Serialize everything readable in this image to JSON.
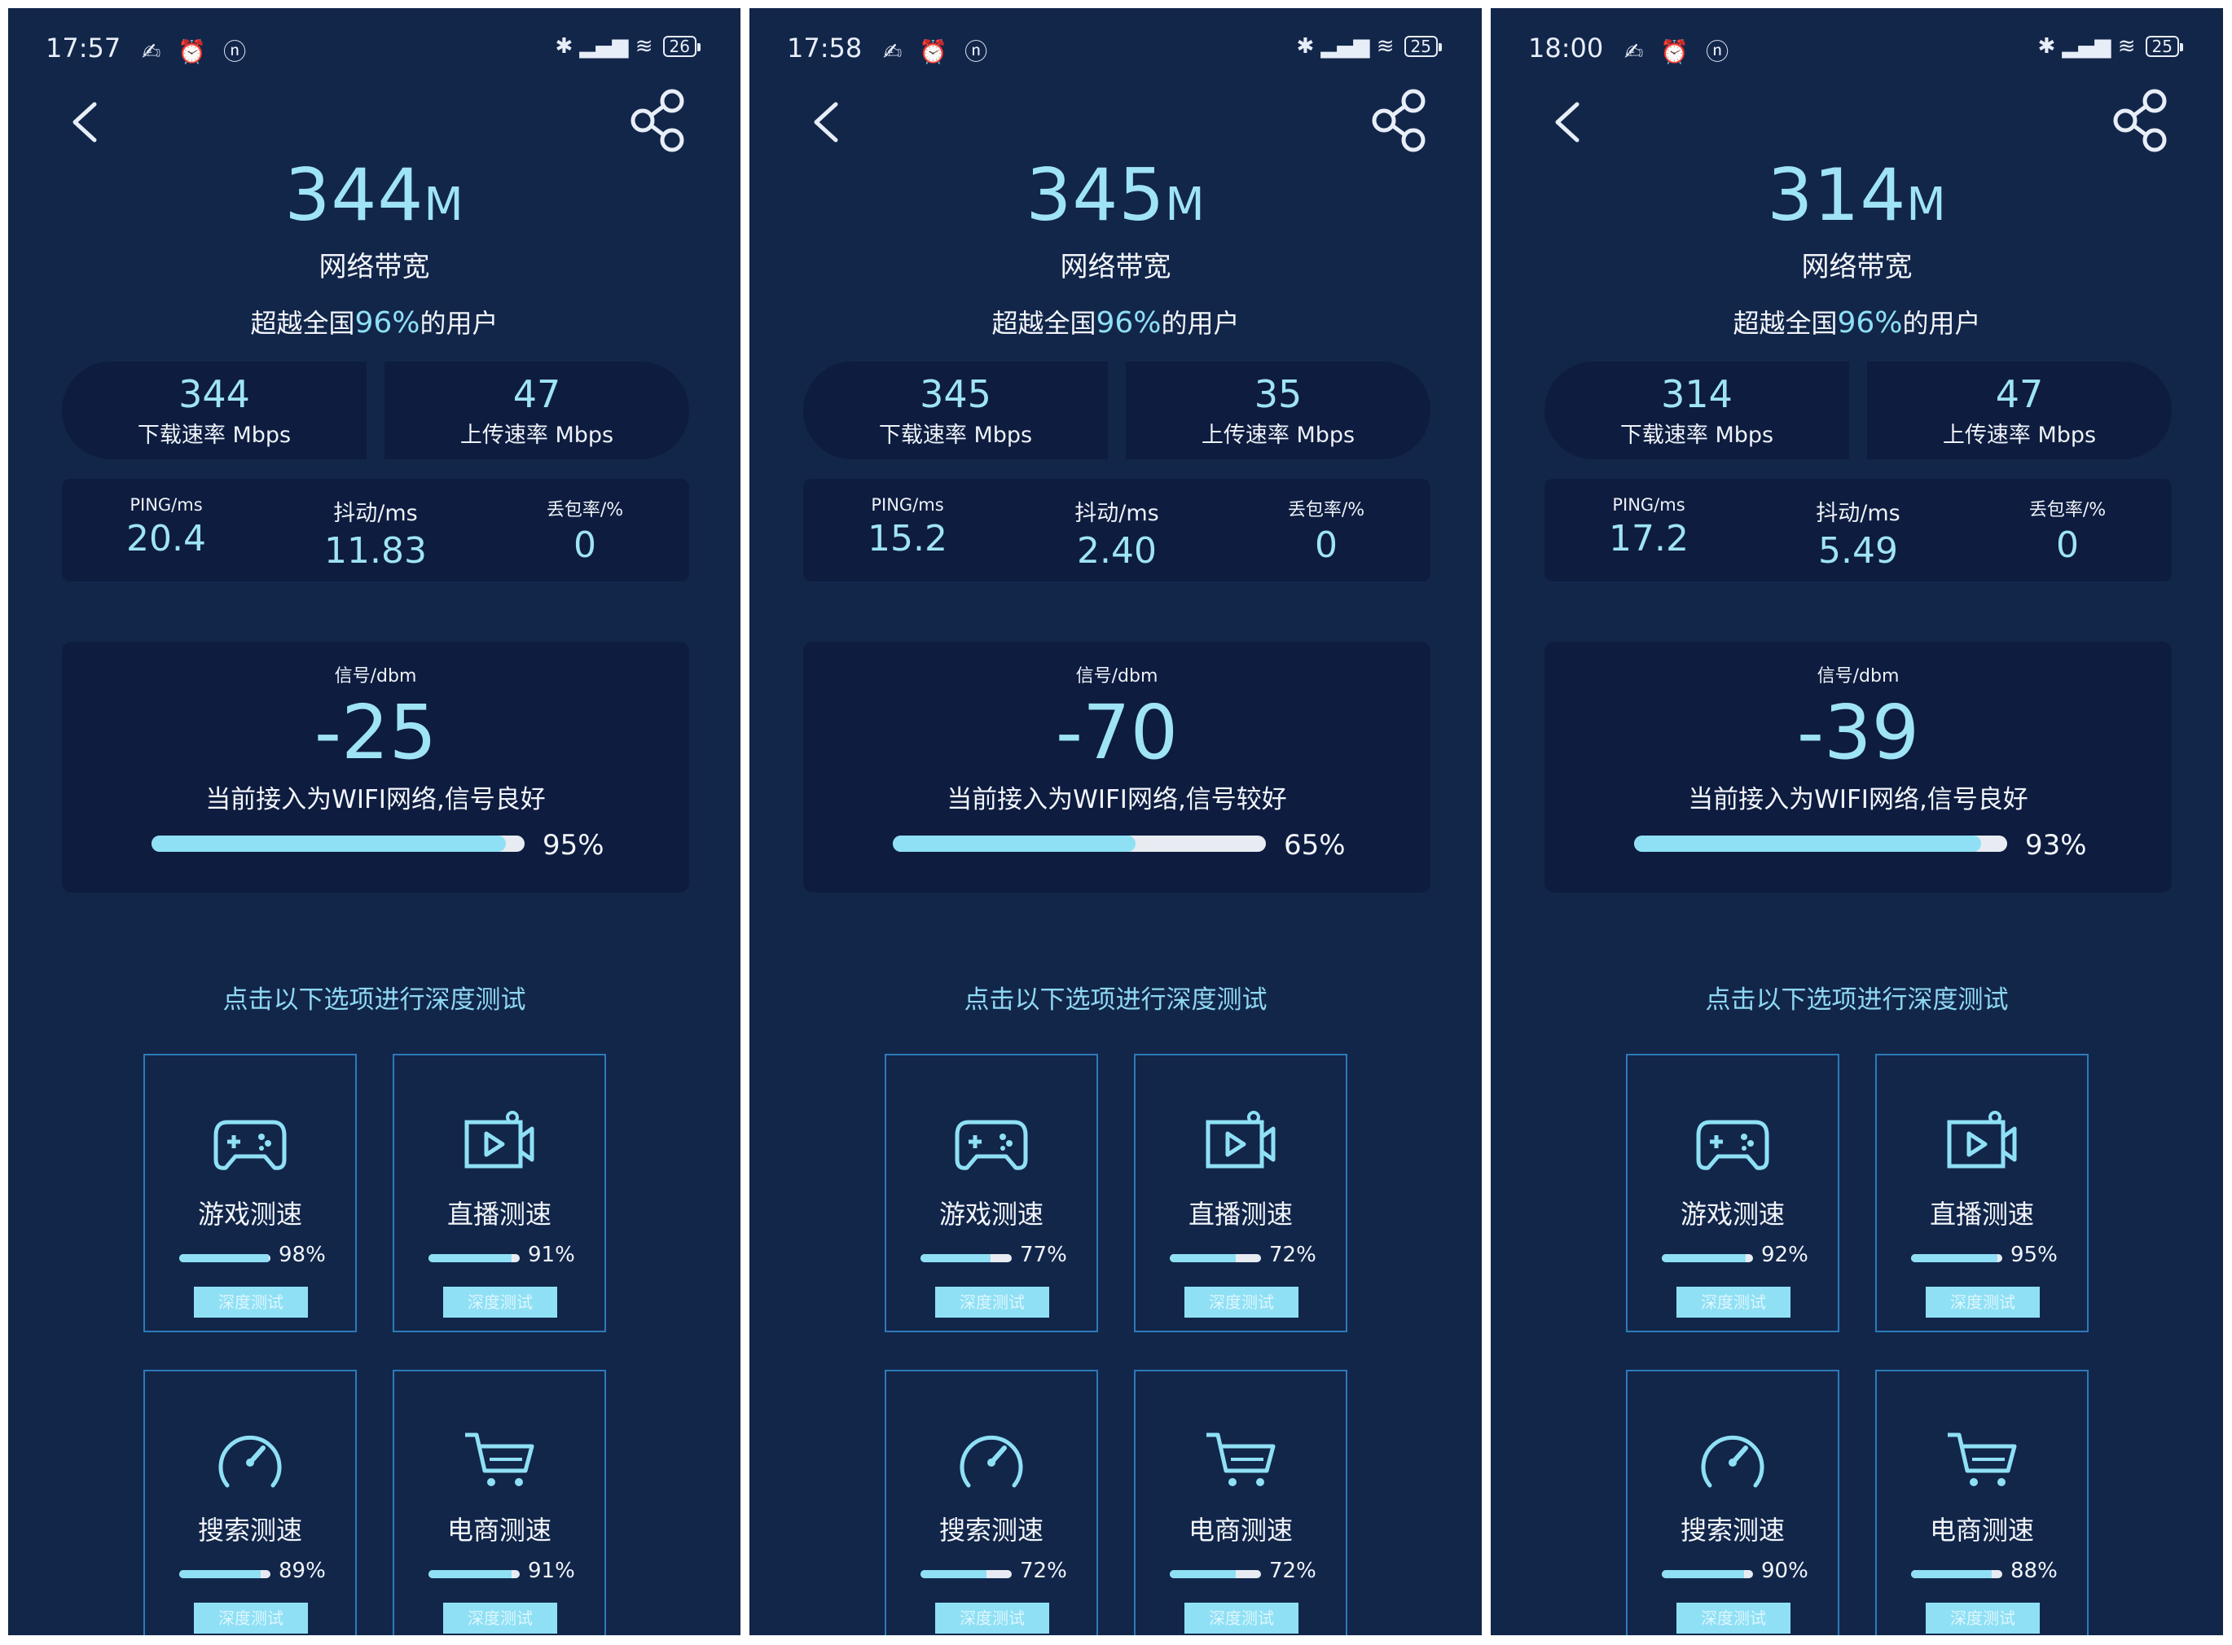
{
  "colors": {
    "background": "#12264a",
    "panel": "#0d1c3f",
    "accent": "#9fe3f7",
    "card_border": "#2d7ab8"
  },
  "screens": [
    {
      "status": {
        "time": "17:57",
        "left_icons": "✍ ⏰ ⓝ",
        "right_icons": "✱ ▂▄▆ ≋",
        "battery": "26"
      },
      "bandwidth": {
        "value": "344",
        "unit": "M",
        "label": "网络带宽"
      },
      "beyond": {
        "prefix": "超越全国",
        "percent": "96%",
        "suffix": "的用户"
      },
      "download": {
        "value": "344",
        "label": "下载速率 Mbps"
      },
      "upload": {
        "value": "47",
        "label": "上传速率 Mbps"
      },
      "ping": {
        "label": "PING/ms",
        "value": "20.4"
      },
      "jitter": {
        "label": "抖动/ms",
        "value": "11.83"
      },
      "loss": {
        "label": "丢包率/%",
        "value": "0"
      },
      "signal": {
        "label": "信号/dbm",
        "value": "-25",
        "message": "当前接入为WIFI网络,信号良好",
        "percent_text": "95%",
        "level": 0.95
      },
      "deep_title": "点击以下选项进行深度测试",
      "cards": [
        {
          "icon": "gamepad-icon",
          "name": "游戏测速",
          "percent_text": "98%",
          "level": 0.98,
          "button": "深度测试"
        },
        {
          "icon": "video-icon",
          "name": "直播测速",
          "percent_text": "91%",
          "level": 0.91,
          "button": "深度测试"
        },
        {
          "icon": "speedometer-icon",
          "name": "搜索测速",
          "percent_text": "89%",
          "level": 0.89,
          "button": "深度测试"
        },
        {
          "icon": "cart-icon",
          "name": "电商测速",
          "percent_text": "91%",
          "level": 0.91,
          "button": "深度测试"
        }
      ]
    },
    {
      "status": {
        "time": "17:58",
        "left_icons": "✍ ⏰ ⓝ",
        "right_icons": "✱ ▂▄▆ ≋",
        "battery": "25"
      },
      "bandwidth": {
        "value": "345",
        "unit": "M",
        "label": "网络带宽"
      },
      "beyond": {
        "prefix": "超越全国",
        "percent": "96%",
        "suffix": "的用户"
      },
      "download": {
        "value": "345",
        "label": "下载速率 Mbps"
      },
      "upload": {
        "value": "35",
        "label": "上传速率 Mbps"
      },
      "ping": {
        "label": "PING/ms",
        "value": "15.2"
      },
      "jitter": {
        "label": "抖动/ms",
        "value": "2.40"
      },
      "loss": {
        "label": "丢包率/%",
        "value": "0"
      },
      "signal": {
        "label": "信号/dbm",
        "value": "-70",
        "message": "当前接入为WIFI网络,信号较好",
        "percent_text": "65%",
        "level": 0.65
      },
      "deep_title": "点击以下选项进行深度测试",
      "cards": [
        {
          "icon": "gamepad-icon",
          "name": "游戏测速",
          "percent_text": "77%",
          "level": 0.77,
          "button": "深度测试"
        },
        {
          "icon": "video-icon",
          "name": "直播测速",
          "percent_text": "72%",
          "level": 0.72,
          "button": "深度测试"
        },
        {
          "icon": "speedometer-icon",
          "name": "搜索测速",
          "percent_text": "72%",
          "level": 0.72,
          "button": "深度测试"
        },
        {
          "icon": "cart-icon",
          "name": "电商测速",
          "percent_text": "72%",
          "level": 0.72,
          "button": "深度测试"
        }
      ]
    },
    {
      "status": {
        "time": "18:00",
        "left_icons": "✍ ⏰ ⓝ",
        "right_icons": "✱ ▂▄▆ ≋",
        "battery": "25"
      },
      "bandwidth": {
        "value": "314",
        "unit": "M",
        "label": "网络带宽"
      },
      "beyond": {
        "prefix": "超越全国",
        "percent": "96%",
        "suffix": "的用户"
      },
      "download": {
        "value": "314",
        "label": "下载速率 Mbps"
      },
      "upload": {
        "value": "47",
        "label": "上传速率 Mbps"
      },
      "ping": {
        "label": "PING/ms",
        "value": "17.2"
      },
      "jitter": {
        "label": "抖动/ms",
        "value": "5.49"
      },
      "loss": {
        "label": "丢包率/%",
        "value": "0"
      },
      "signal": {
        "label": "信号/dbm",
        "value": "-39",
        "message": "当前接入为WIFI网络,信号良好",
        "percent_text": "93%",
        "level": 0.93
      },
      "deep_title": "点击以下选项进行深度测试",
      "cards": [
        {
          "icon": "gamepad-icon",
          "name": "游戏测速",
          "percent_text": "92%",
          "level": 0.92,
          "button": "深度测试"
        },
        {
          "icon": "video-icon",
          "name": "直播测速",
          "percent_text": "95%",
          "level": 0.95,
          "button": "深度测试"
        },
        {
          "icon": "speedometer-icon",
          "name": "搜索测速",
          "percent_text": "90%",
          "level": 0.9,
          "button": "深度测试"
        },
        {
          "icon": "cart-icon",
          "name": "电商测速",
          "percent_text": "88%",
          "level": 0.88,
          "button": "深度测试"
        }
      ]
    }
  ]
}
